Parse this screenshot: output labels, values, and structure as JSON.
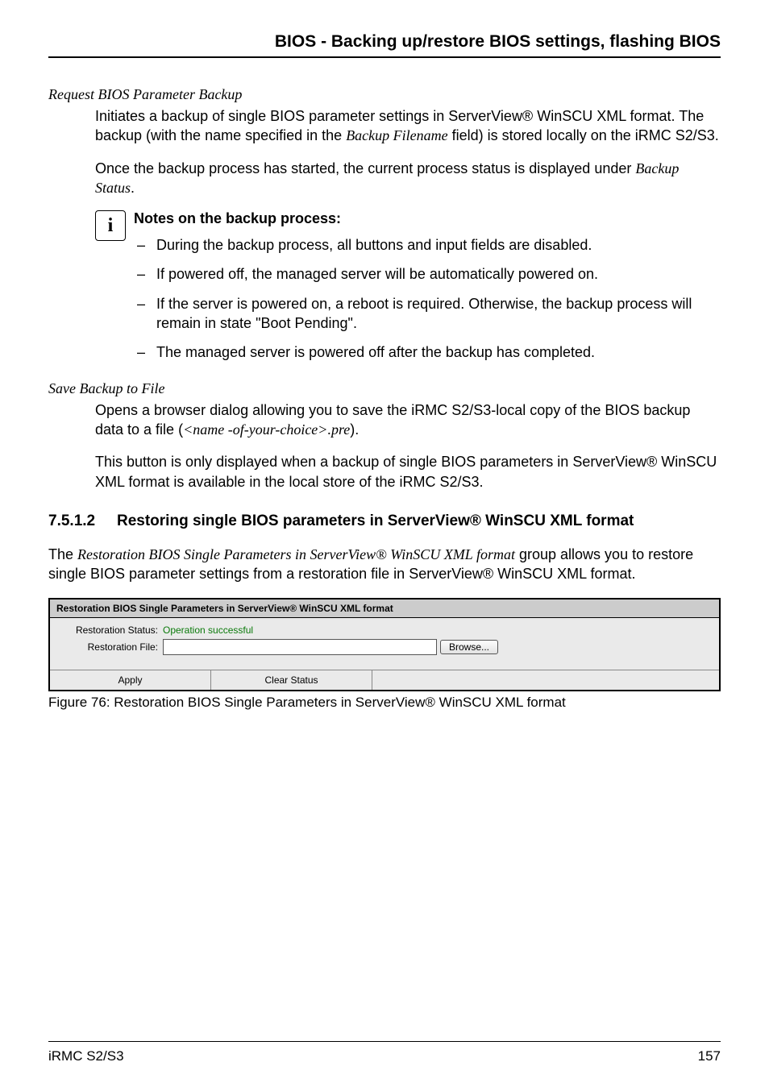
{
  "header": {
    "title": "BIOS - Backing up/restore BIOS settings, flashing BIOS"
  },
  "s1": {
    "label": "Request BIOS Parameter Backup",
    "p1a": "Initiates a backup of single BIOS parameter settings in ServerView® WinSCU XML format. The backup (with the name specified in the ",
    "p1_em": "Backup Filename",
    "p1b": " field) is stored locally on the iRMC S2/S3.",
    "p2a": "Once the backup process has started, the current process status is displayed under ",
    "p2_em": "Backup Status",
    "p2b": "."
  },
  "notes": {
    "title": "Notes on the backup process:",
    "b1": "During the backup process, all buttons and input fields are disabled.",
    "b2": "If powered off, the managed server will be automatically powered on.",
    "b3": "If the server is powered on, a reboot is required. Otherwise, the backup process will remain in state \"Boot Pending\".",
    "b4": "The managed server is powered off after the backup has completed."
  },
  "s2": {
    "label": "Save Backup to File",
    "p1a": "Opens a browser dialog allowing you to save the iRMC S2/S3-local copy of the BIOS backup data to a file (",
    "p1_em": "<name -of-your-choice>.pre",
    "p1b": ").",
    "p2": "This button is only displayed when a backup of single BIOS parameters in ServerView® WinSCU XML format is available in the local store of the iRMC S2/S3."
  },
  "sub": {
    "num": "7.5.1.2",
    "title": "Restoring single BIOS parameters in ServerView® WinSCU XML format"
  },
  "intro": {
    "a": "The ",
    "em": "Restoration BIOS Single Parameters in ServerView® WinSCU XML format",
    "b": " group allows you to restore single BIOS parameter settings from a restoration file in ServerView® WinSCU XML format."
  },
  "ui": {
    "panel_title": "Restoration BIOS Single Parameters in ServerView® WinSCU XML format",
    "status_label": "Restoration Status:",
    "status_value": "Operation successful",
    "file_label": "Restoration File:",
    "file_value": "",
    "browse": "Browse...",
    "apply": "Apply",
    "clear": "Clear Status"
  },
  "caption": "Figure 76: Restoration BIOS Single Parameters in ServerView® WinSCU XML format",
  "footer": {
    "left": "iRMC S2/S3",
    "right": "157"
  }
}
